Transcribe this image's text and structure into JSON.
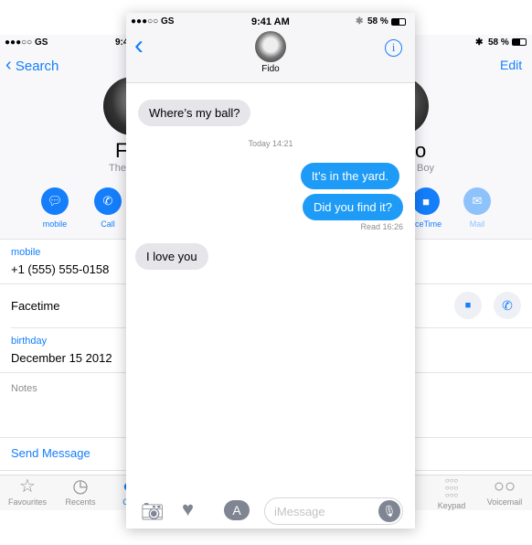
{
  "contact": {
    "status": {
      "carrier": "●●●○○ GS",
      "time": "9:41 AM",
      "battery": "58 %"
    },
    "nav": {
      "back_label": "Search",
      "edit_label": "Edit"
    },
    "name_left": "F",
    "name_right": "o",
    "subtitle_left": "The",
    "subtitle_right": "Boy",
    "actions": [
      {
        "label": "mobile",
        "icon": "message-icon"
      },
      {
        "label": "Call",
        "icon": "phone-icon"
      },
      {
        "label": "FaceTime",
        "visible_label": "ceTime",
        "icon": "video-icon"
      },
      {
        "label": "Mail",
        "icon": "mail-icon"
      }
    ],
    "fields": {
      "mobile_label": "mobile",
      "mobile_value": "+1 (555) 555-0158",
      "facetime_label": "Facetime",
      "birthday_label": "birthday",
      "birthday_value": "December 15 2012",
      "notes_label": "Notes",
      "send_message": "Send Message"
    },
    "tabs": [
      {
        "label": "Favourites",
        "icon": "star-icon"
      },
      {
        "label": "Recents",
        "icon": "clock-icon"
      },
      {
        "label": "Co",
        "icon": "contacts-icon"
      },
      {
        "label": "Keypad",
        "icon": "keypad-icon"
      },
      {
        "label": "Voicemail",
        "icon": "voicemail-icon"
      }
    ]
  },
  "messages": {
    "status": {
      "carrier": "●●●○○ GS",
      "time": "9:41 AM",
      "battery": "58 %"
    },
    "contact_name": "Fido",
    "thread": [
      {
        "dir": "in",
        "text": "Where’s my ball?"
      },
      {
        "type": "timestamp",
        "text": "Today 14:21"
      },
      {
        "dir": "out",
        "text": "It’s in the yard."
      },
      {
        "dir": "out",
        "text": "Did you find it?"
      },
      {
        "type": "receipt",
        "text": "Read 16:26"
      },
      {
        "dir": "in",
        "text": "I love you"
      }
    ],
    "input_placeholder": "iMessage"
  },
  "colors": {
    "accent": "#147efb",
    "outgoing": "#1d9bf6",
    "incoming": "#e5e5ea"
  }
}
